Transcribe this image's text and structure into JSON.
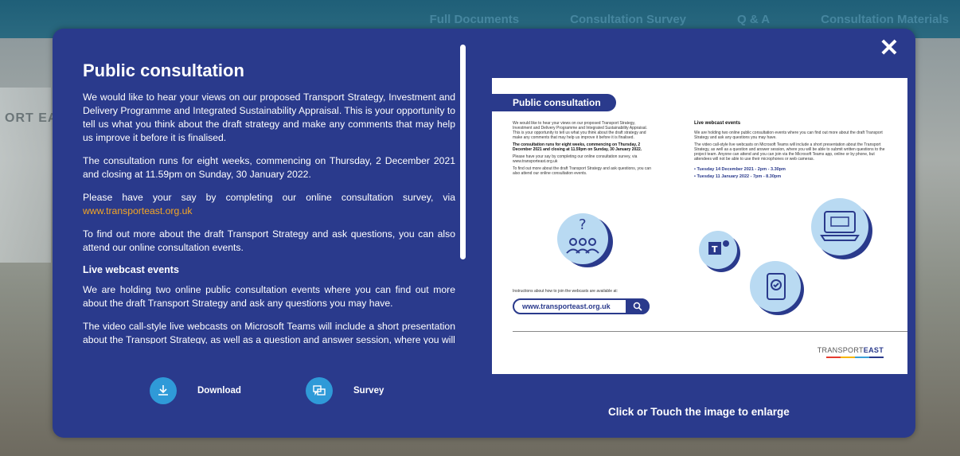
{
  "nav": {
    "items": [
      "Full Documents",
      "Consultation Survey",
      "Q & A",
      "Consultation Materials"
    ]
  },
  "background": {
    "side_text": "ORT EAST"
  },
  "modal": {
    "title": "Public consultation",
    "paragraphs": [
      "We would like to hear your views on our proposed Transport Strategy, Investment and Delivery Programme and Integrated Sustainability Appraisal. This is your opportunity to tell us what you think about the draft strategy and make any comments that may help us improve it before it is finalised.",
      "The consultation runs for eight weeks, commencing on Thursday, 2 December 2021 and closing at 11.59pm on Sunday, 30 January 2022."
    ],
    "survey_para_prefix": "Please have your say by completing our online consultation survey, via",
    "survey_link": "www.transporteast.org.uk",
    "para_events": "To find out more about the draft Transport Strategy and ask questions, you can also attend our online consultation events.",
    "webcast_heading": "Live webcast events",
    "webcast_paragraphs": [
      "We are holding two online public consultation events where you can find out more about the draft Transport Strategy and ask any questions you may have.",
      "The video call-style live webcasts on Microsoft Teams will include a short presentation about the Transport Strategy, as well as a question and answer session, where you will"
    ],
    "download_label": "Download",
    "survey_label": "Survey",
    "enlarge_label": "Click or Touch the  image to enlarge",
    "close_symbol": "✕"
  },
  "preview": {
    "title": "Public consultation",
    "col1": [
      "We would like to hear your views on our proposed Transport Strategy, Investment and Delivery Programme and Integrated Sustainability Appraisal. This is your opportunity to tell us what you think about the draft strategy and make any comments that may help us improve it before it is finalised.",
      "The consultation runs for eight weeks, commencing on Thursday, 2 December 2021 and closing at 11.59pm on Sunday, 30 January 2022.",
      "Please have your say by completing our online consultation survey, via www.transporteast.org.uk",
      "To find out more about the draft Transport Strategy and ask questions, you can also attend our online consultation events."
    ],
    "col2_heading": "Live webcast events",
    "col2": [
      "We are holding two online public consultation events where you can find out more about the draft Transport Strategy and ask any questions you may have.",
      "The video call-style live webcasts on Microsoft Teams will include a short presentation about the Transport Strategy, as well as a question and answer session, where you will be able to submit written questions to the project team. Anyone can attend and you can join via the Microsoft Teams app, online or by phone, but attendees will not be able to use their microphones or web cameras."
    ],
    "dates": [
      "• Tuesday 14 December 2021 - 2pm - 3.30pm",
      "• Tuesday 11 January 2022 - 7pm - 8.30pm"
    ],
    "instructions": "Instructions about how to join the webcasts are available at:",
    "url": "www.transporteast.org.uk",
    "logo_light": "TRANSPORT",
    "logo_bold": "EAST"
  },
  "colors": {
    "modal_bg": "#2a3a8c",
    "accent_blue": "#2f9ad8",
    "link": "#f5a623"
  }
}
